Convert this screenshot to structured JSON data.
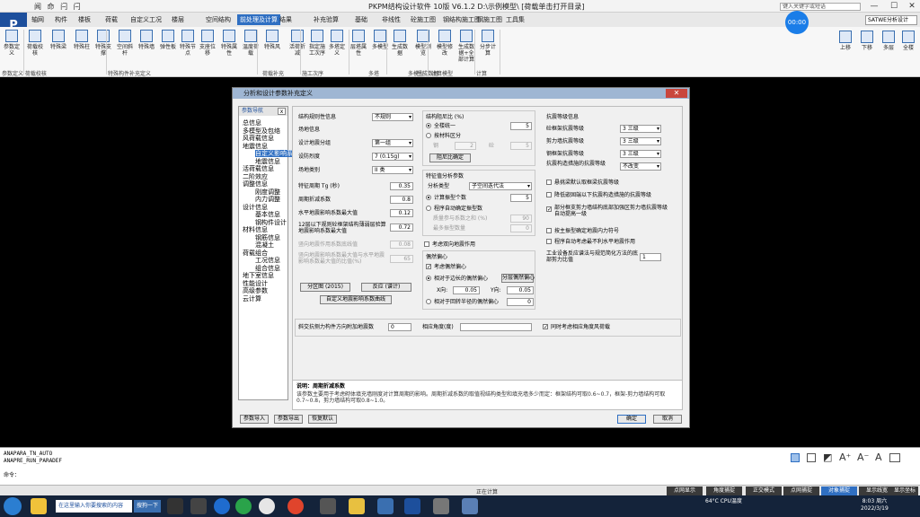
{
  "app": {
    "title": "PKPM结构设计软件 10版 V6.1.2 D:\\示例模型\\ [荷载单击打开目录]",
    "quick_access": "闻 命 闩 闩",
    "logo": "P",
    "search_placeholder": "键入关键字或短语",
    "module_select": "SATWE分析设计"
  },
  "ribbon_tabs": [
    "轴网",
    "构件",
    "楼板",
    "荷载",
    "自定义工况",
    "楼层",
    "空间结构",
    "前处理及计算",
    "结果",
    "补充验算",
    "基础",
    "非线性",
    "砼施工图",
    "钢结构施工图",
    "钢施工图",
    "工具集"
  ],
  "ribbon_active_tab": 7,
  "ribbon_buttons": [
    {
      "label": "参数定义"
    },
    {
      "label": "荷载校核"
    },
    {
      "label": "特殊梁"
    },
    {
      "label": "特殊柱"
    },
    {
      "label": "特殊支撑"
    },
    {
      "label": "空间斜杆"
    },
    {
      "label": "特殊墙"
    },
    {
      "label": "弹性板"
    },
    {
      "label": "特殊节点"
    },
    {
      "label": "支座位移"
    },
    {
      "label": "特殊属性"
    },
    {
      "label": "温度荷载"
    },
    {
      "label": "特殊风"
    },
    {
      "label": "活荷折减"
    },
    {
      "label": "指定施工次序"
    },
    {
      "label": "多塔定义"
    },
    {
      "label": "层塔属性"
    },
    {
      "label": "多模型"
    },
    {
      "label": "生成数据"
    },
    {
      "label": "模型浏览"
    },
    {
      "label": "模型修改"
    },
    {
      "label": "生成数据+全部计算"
    },
    {
      "label": "分步计算"
    }
  ],
  "ribbon_groups": [
    "参数定义 荷载校核",
    "特殊构件补充定义",
    "荷载补充",
    "施工次序",
    "多塔",
    "多模型",
    "生成数据",
    "计算模型",
    "计算"
  ],
  "clock_button": "00:00",
  "right_buttons": [
    {
      "label": "上移"
    },
    {
      "label": "下移"
    },
    {
      "label": "多层"
    },
    {
      "label": "全楼"
    }
  ],
  "dialog": {
    "title": "分析和设计参数补充定义",
    "close": "✕",
    "nav_header": "参数导航",
    "nav_close": "x",
    "nav_items": [
      "总信息",
      "多模型及包络",
      "风荷载信息",
      "地震信息",
      "自定义影响系数",
      "地震信息",
      "活荷载信息",
      "二阶效应",
      "调整信息",
      "刚度调整",
      "内力调整",
      "设计信息",
      "基本信息",
      "钢构件设计",
      "材料信息",
      "钢筋信息",
      "混凝土",
      "荷载组合",
      "工况信息",
      "组合信息",
      "地下室信息",
      "性能设计",
      "高级参数",
      "云计算"
    ],
    "nav_selected": 4,
    "left": {
      "struct_rule_label": "结构规则性信息",
      "struct_rule_value": "不规则",
      "site_info": "场地信息",
      "group_label": "设计地震分组",
      "group_value": "第一组",
      "intensity_label": "设防烈度",
      "intensity_value": "7 (0.15g)",
      "site_class_label": "场地类别",
      "site_class_value": "II 类",
      "tg_label": "特征周期 Tg (秒)",
      "tg_value": "0.35",
      "period_factor_label": "周期折减系数",
      "period_factor_value": "0.8",
      "amax_label": "水平地震影响系数最大值",
      "amax_value": "0.12",
      "amax_small_label": "12层以下规则砼框架结构薄弱层验算地震影响系数最大值",
      "amax_small_value": "0.72",
      "vert_label": "竖向地震作用系数底线值",
      "vert_value": "0.08",
      "vert_ratio_label": "竖向地震影响系数最大值与水平地震影响系数最大值的比值(%)",
      "vert_ratio_value": "65",
      "btn_zone": "分区图 (2015)",
      "btn_calc": "反应 (谱计)",
      "btn_custom": "自定义地震影响系数曲线"
    },
    "mid": {
      "calc_mode_label": "结构阻尼比 (%)",
      "all_one": "全楼统一",
      "all_one_value": "5",
      "by_material": "按材料区分",
      "steel_label": "钢",
      "steel_value": "2",
      "concrete_label": "砼",
      "concrete_value": "5",
      "btn_damp": "阻尼比确定",
      "modal_label": "特征值分析参数",
      "analysis_type_label": "分析类型",
      "analysis_type_value": "子空间迭代法",
      "user_modes": "计算振型个数",
      "user_modes_value": "5",
      "auto_modes": "程序自动确定振型数",
      "mass_ratio_label": "质量参与系数之和 (%)",
      "mass_ratio_value": "90",
      "max_modes_label": "最多振型数量",
      "max_modes_value": "0",
      "by_pos_label": "考虑双向地震作用",
      "eccentric": "偶然偏心",
      "consider_ecc": "考虑偶然偏心",
      "rel_ecc": "相对于边长的偶然偏心",
      "btn_ecc": "分层偶然偏心",
      "x_label": "X向:",
      "x_value": "0.05",
      "y_label": "Y向:",
      "y_value": "0.05",
      "rel_radius": "相对于回转半径的偶然偏心",
      "rel_radius_value": "0"
    },
    "right": {
      "seismic_title": "抗震等级信息",
      "conc_frame_label": "砼框架抗震等级",
      "conc_frame_value": "3 三级",
      "shear_wall_label": "剪力墙抗震等级",
      "shear_wall_value": "3 三级",
      "steel_frame_label": "钢框架抗震等级",
      "steel_frame_value": "3 三级",
      "measures_label": "抗震构造措施的抗震等级",
      "measures_value": "不改变",
      "chk1": "悬挑梁默认取框梁抗震等级",
      "chk2": "降低嵌固端以下抗震构造措施的抗震等级",
      "chk3": "部分框支剪力墙结构底部加强区剪力墙抗震等级自动提高一级",
      "chk4": "按主振型确定地震内力符号",
      "chk5": "程序自动考虑最不利水平地震作用",
      "angle_label": "工业设备反应谱法与规范简化方法的底部剪力比值",
      "angle_value": "1"
    },
    "bottom": {
      "extra_angle_label": "斜交抗侧力构件方向附加地震数",
      "extra_angle_value": "0",
      "extra_dir_label": "相应角度(度)",
      "extra_dir_value": "",
      "chk_anti": "同时考虑相应角度风荷载"
    },
    "desc_title": "说明：周期折减系数",
    "desc_text": "该参数主要用于考虑砌体填充墙刚度对计算周期的影响。周期折减系数的取值视结构类型和填充墙多少而定：框架结构可取0.6~0.7，框架-剪力墙结构可取0.7~0.8，剪力墙结构可取0.8~1.0。",
    "footer_buttons": [
      "参数导入",
      "参数导出",
      "恢复默认"
    ],
    "ok": "确定",
    "cancel": "取消"
  },
  "cmd_lines": [
    "ANAPARA_TN_AUTO",
    "ANAPRE_RUN_PARADEF",
    "命令："
  ],
  "status_buttons": [
    "点网显示",
    "角度捕捉",
    "正交模式",
    "点网捕捉",
    "对象捕捉",
    "显示线宽",
    "显示坐标"
  ],
  "status_active": 4,
  "status_center": "正在计算",
  "taskbar": {
    "input_text": "在这里输入你要搜索的内容",
    "sogou": "搜狗一下",
    "tray": "64°C  CPU温度",
    "time": "8:03 周六",
    "date": "2022/3/19"
  }
}
